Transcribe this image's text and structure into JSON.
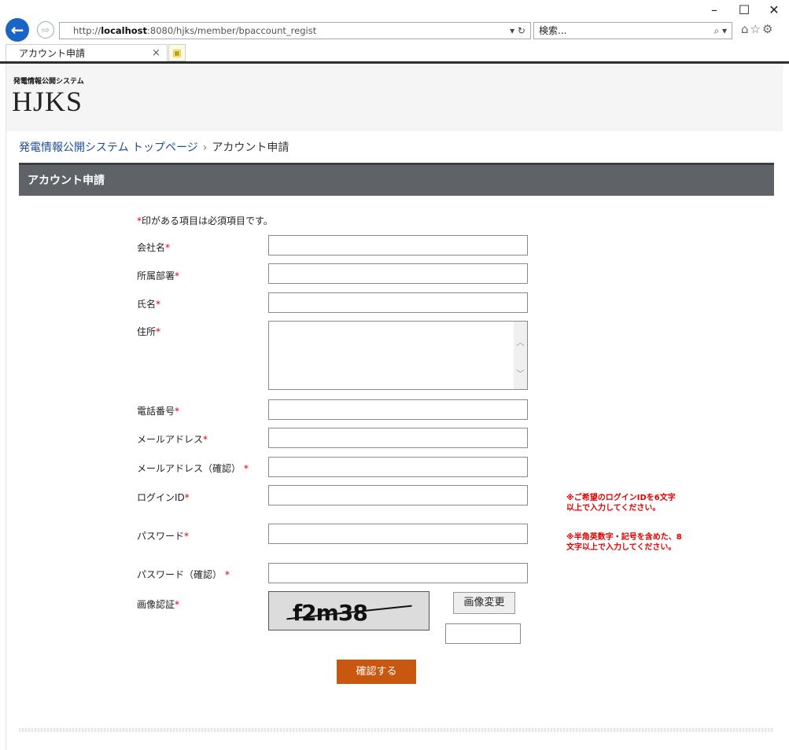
{
  "window": {
    "minimize": "–",
    "maximize": "☐",
    "close": "✕"
  },
  "browser": {
    "url_prefix": "http://",
    "url_host": "localhost",
    "url_rest": ":8080/hjks/member/bpaccount_regist",
    "url_tools": "▾ ↻",
    "search_placeholder": "検索...",
    "search_icon": "⌕ ▾",
    "toolbar_icons": "⌂☆⚙",
    "tab_title": "アカウント申請",
    "tab_close": "×",
    "back_icon": "←",
    "forward_icon": "⇨",
    "newtab_icon": "▣"
  },
  "header": {
    "logo_sub": "発電情報公開システム",
    "logo_main": "HJKS"
  },
  "breadcrumb": {
    "home": "発電情報公開システム トップページ",
    "sep": "›",
    "current": "アカウント申請"
  },
  "section": {
    "title": "アカウント申請"
  },
  "form": {
    "required_mark": "*",
    "required_note": "印がある項目は必須項目です。",
    "fields": {
      "company": "会社名",
      "department": "所属部署",
      "name": "氏名",
      "address": "住所",
      "phone": "電話番号",
      "email": "メールアドレス",
      "email_confirm": "メールアドレス（確認）",
      "login_id": "ログインID",
      "password": "パスワード",
      "password_confirm": "パスワード（確認）",
      "captcha": "画像認証"
    },
    "hints": {
      "login_id_1": "※ご希望のログインIDを6文字",
      "login_id_2": "以上で入力してください。",
      "password_1": "※半角英数字・記号を含めた、8",
      "password_2": "文字以上で入力してください。"
    },
    "captcha_text": "f2m38",
    "captcha_change": "画像変更",
    "confirm": "確認する"
  }
}
